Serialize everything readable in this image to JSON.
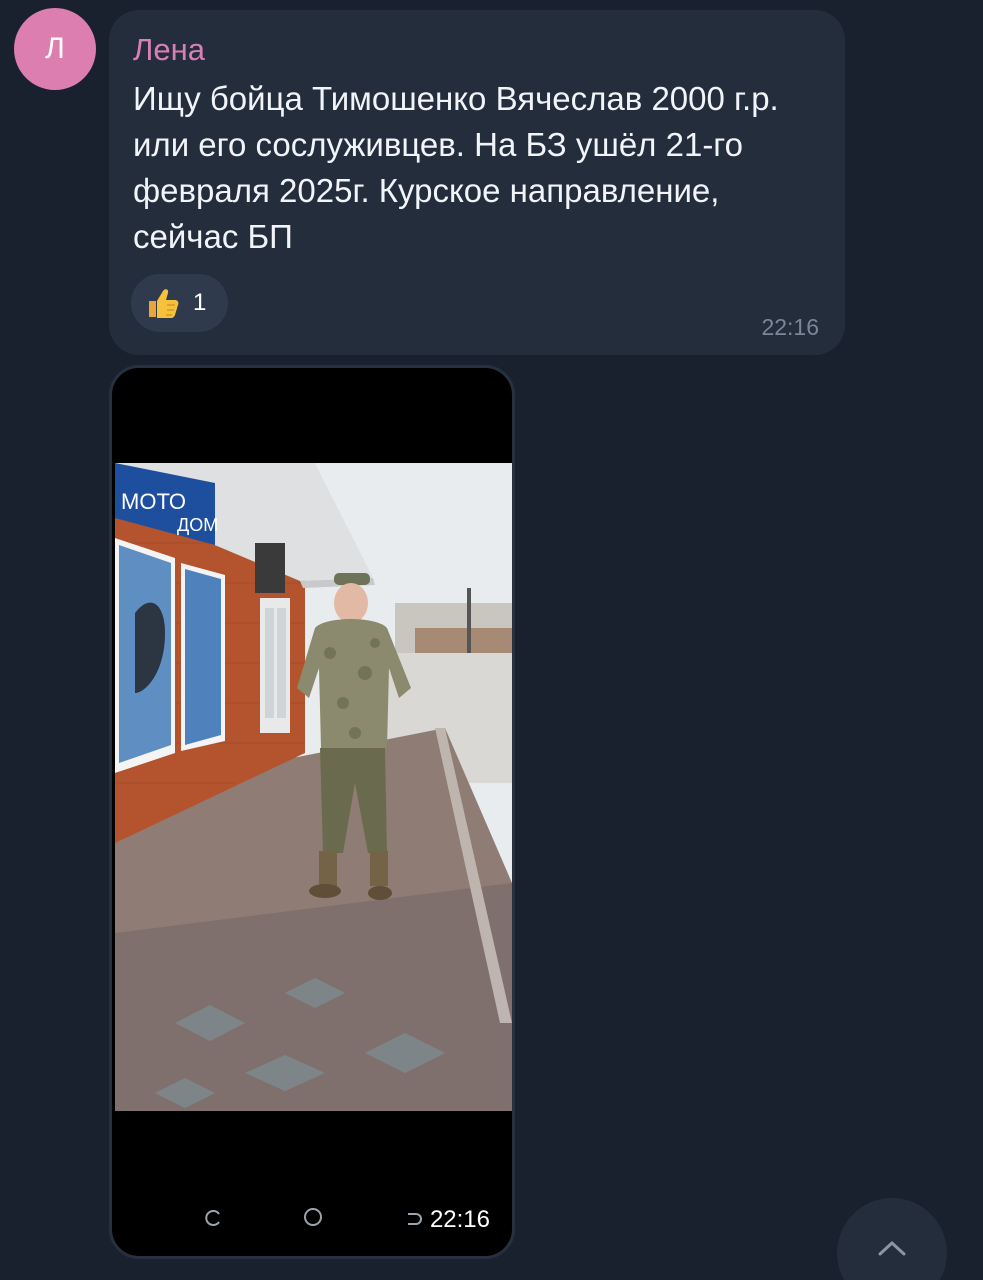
{
  "message": {
    "avatar_letter": "Л",
    "sender": "Лена",
    "text": "Ищу бойца Тимошенко Вячеслав 2000 г.р.\nили его сослуживцев. На БЗ ушёл 21-го\nфевраля 2025г. Курское направление,\nсейчас БП",
    "reaction": {
      "icon": "thumbs-up-icon",
      "count": "1"
    },
    "time": "22:16"
  },
  "photo_message": {
    "sign_text_1": "МОТО",
    "sign_text_2": "ДОМ",
    "time": "22:16"
  },
  "colors": {
    "background": "#18212d",
    "bubble": "#232d3c",
    "sender": "#d97fb7",
    "avatar": "#dc7fb0"
  }
}
